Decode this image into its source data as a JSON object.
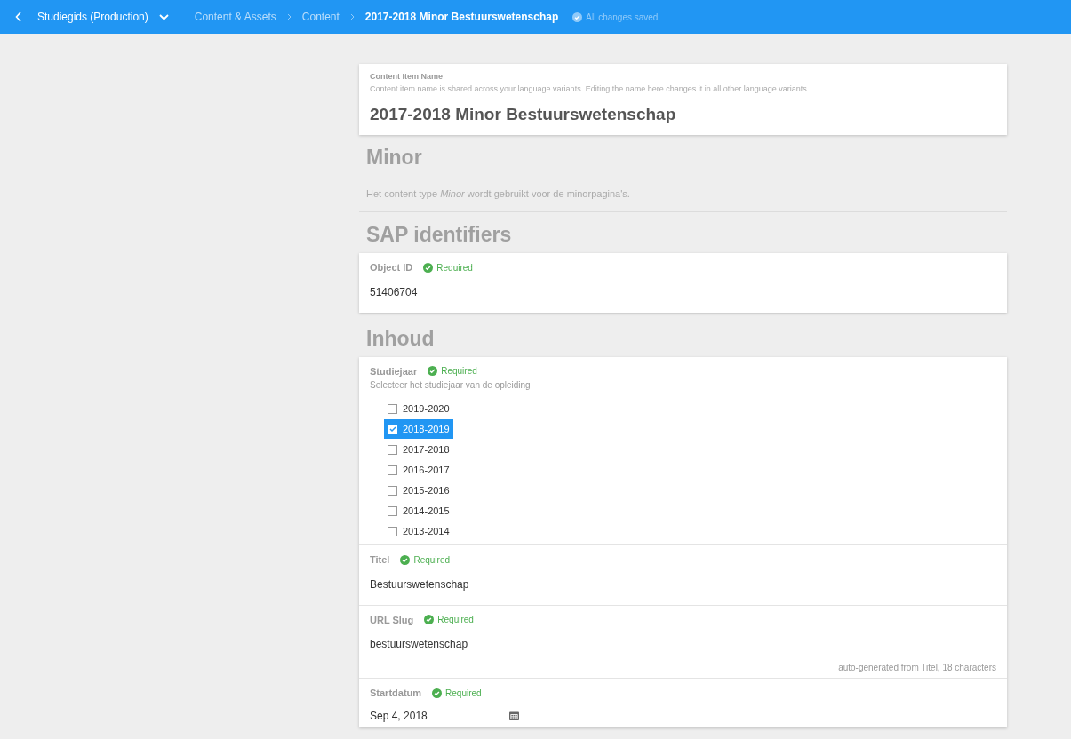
{
  "topbar": {
    "project": "Studiegids (Production)",
    "breadcrumbs": [
      "Content & Assets",
      "Content"
    ],
    "current": "2017-2018 Minor Bestuurswetenschap",
    "status": "All changes saved"
  },
  "item_name": {
    "label": "Content Item Name",
    "help": "Content item name is shared across your language variants. Editing the name here changes it in all other language variants.",
    "value": "2017-2018 Minor Bestuurswetenschap"
  },
  "blocks": [
    {
      "kind": "heading",
      "text": "Minor"
    },
    {
      "kind": "description",
      "text": "Het content type *Minor* wordt gebruikt voor de minorpagina's."
    },
    {
      "kind": "heading",
      "text": "SAP identifiers"
    },
    {
      "kind": "card",
      "fields": [
        {
          "kind": "text",
          "label": "Object ID",
          "badge": "Required",
          "value": "51406704"
        }
      ]
    },
    {
      "kind": "heading",
      "text": "Inhoud"
    },
    {
      "kind": "card",
      "fields": [
        {
          "kind": "checklist",
          "label": "Studiejaar",
          "badge": "Required",
          "hint": "Selecteer het studiejaar van de opleiding",
          "options": [
            {
              "label": "2019-2020",
              "checked": false
            },
            {
              "label": "2018-2019",
              "checked": true
            },
            {
              "label": "2017-2018",
              "checked": false
            },
            {
              "label": "2016-2017",
              "checked": false
            },
            {
              "label": "2015-2016",
              "checked": false
            },
            {
              "label": "2014-2015",
              "checked": false
            },
            {
              "label": "2013-2014",
              "checked": false
            }
          ]
        },
        {
          "kind": "text",
          "label": "Titel",
          "badge": "Required",
          "value": "Bestuurswetenschap"
        },
        {
          "kind": "text",
          "label": "URL Slug",
          "badge": "Required",
          "value": "bestuurswetenschap",
          "note": "auto-generated from Titel, 18 characters"
        },
        {
          "kind": "date",
          "label": "Startdatum",
          "badge": "Required",
          "value": "Sep 4, 2018"
        }
      ]
    }
  ]
}
